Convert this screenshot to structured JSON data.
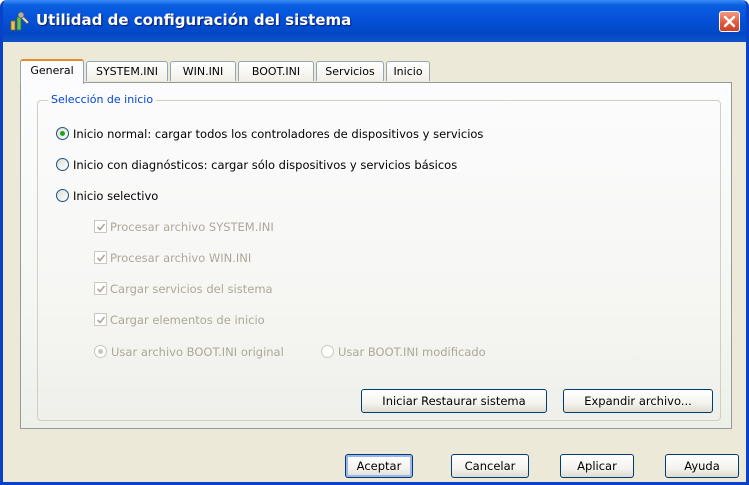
{
  "window": {
    "title": "Utilidad de configuración del sistema"
  },
  "tabs": [
    "General",
    "SYSTEM.INI",
    "WIN.INI",
    "BOOT.INI",
    "Servicios",
    "Inicio"
  ],
  "active_tab": "General",
  "startup": {
    "group_title": "Selección de inicio",
    "normal": {
      "label": "Inicio normal: cargar todos los controladores de dispositivos y servicios",
      "selected": true
    },
    "diagnostic": {
      "label": "Inicio con diagnósticos: cargar sólo dispositivos y servicios básicos",
      "selected": false
    },
    "selective": {
      "label": "Inicio selectivo",
      "selected": false
    },
    "options": [
      {
        "label": "Procesar archivo SYSTEM.INI",
        "checked": true,
        "enabled": false
      },
      {
        "label": "Procesar archivo WIN.INI",
        "checked": true,
        "enabled": false
      },
      {
        "label": "Cargar servicios del sistema",
        "checked": true,
        "enabled": false
      },
      {
        "label": "Cargar elementos de inicio",
        "checked": true,
        "enabled": false
      }
    ],
    "boot_original": {
      "label": "Usar archivo BOOT.INI original",
      "selected": true,
      "enabled": false
    },
    "boot_modified": {
      "label": "Usar BOOT.INI modificado",
      "selected": false,
      "enabled": false
    }
  },
  "panel_buttons": {
    "restore": "Iniciar Restaurar sistema",
    "expand": "Expandir archivo..."
  },
  "dialog_buttons": {
    "ok": "Aceptar",
    "cancel": "Cancelar",
    "apply": "Aplicar",
    "help": "Ayuda"
  },
  "colors": {
    "titlebar": "#0551d8",
    "dialog_bg": "#ece9d8",
    "group_title": "#0046d5",
    "radio_selected": "#21a121",
    "close_button": "#e2563a",
    "active_tab_accent": "#e68b2c"
  },
  "icons": {
    "app": "msconfig-tools-icon",
    "close": "close-icon",
    "check": "checkmark-icon"
  }
}
